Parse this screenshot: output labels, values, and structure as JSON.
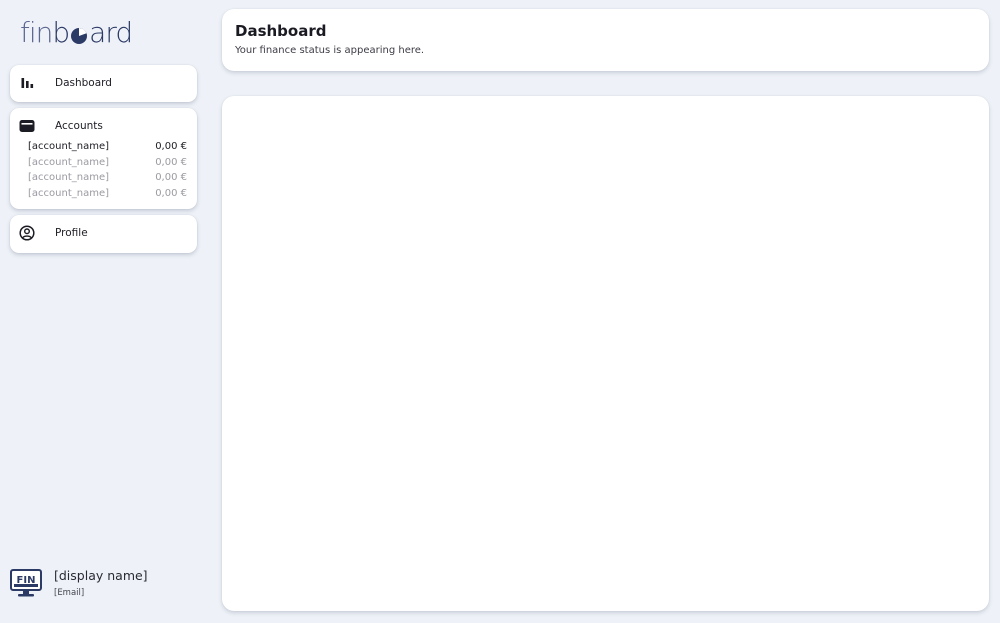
{
  "app": {
    "logo_part_a": "fin",
    "logo_part_b": "ard",
    "brand_color": "#2c3a66"
  },
  "sidebar": {
    "dashboard": {
      "label": "Dashboard",
      "icon": "bar-chart-icon"
    },
    "accounts": {
      "label": "Accounts",
      "icon": "wallet-icon",
      "items": [
        {
          "name": "[account_name]",
          "balance": "0,00 €"
        },
        {
          "name": "[account_name]",
          "balance": "0,00 €"
        },
        {
          "name": "[account_name]",
          "balance": "0,00 €"
        },
        {
          "name": "[account_name]",
          "balance": "0,00 €"
        }
      ]
    },
    "profile": {
      "label": "Profile",
      "icon": "user-circle-icon"
    },
    "user": {
      "display_name": "[display name]",
      "email": "[Email]",
      "avatar_text": "FIN"
    }
  },
  "header": {
    "title": "Dashboard",
    "subtitle": "Your finance status is appearing here."
  }
}
